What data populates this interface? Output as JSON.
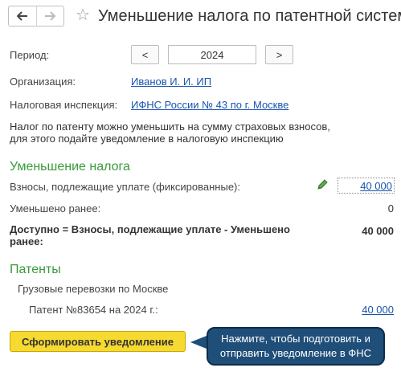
{
  "header": {
    "title": "Уменьшение налога по патентной системе"
  },
  "period": {
    "label": "Период:",
    "prev": "<",
    "year": "2024",
    "next": ">"
  },
  "organization": {
    "label": "Организация:",
    "value": "Иванов И. И. ИП"
  },
  "tax_office": {
    "label": "Налоговая инспекция:",
    "value": "ИФНС России № 43 по г. Москве"
  },
  "info": {
    "line1": "Налог по патенту можно уменьшить на сумму страховых взносов,",
    "line2": "для этого подайте уведомление в налоговую инспекцию"
  },
  "reduction": {
    "heading": "Уменьшение налога",
    "contributions_label": "Взносы, подлежащие уплате (фиксированные):",
    "contributions_value": "40 000",
    "reduced_label": "Уменьшено ранее:",
    "reduced_value": "0",
    "available_label_1": "Доступно = Взносы, подлежащие уплате - Уменьшено",
    "available_label_2": "ранее:",
    "available_value": "40 000"
  },
  "patents": {
    "heading": "Патенты",
    "group": "Грузовые перевозки по Москве",
    "item_label": "Патент №83654 на 2024 г.:",
    "item_value": "40 000"
  },
  "actions": {
    "submit": "Сформировать уведомление"
  },
  "tooltip": {
    "line1": "Нажмите, чтобы подготовить и",
    "line2": "отправить уведомление в ФНС"
  },
  "icons": {
    "back": "arrow-left-icon",
    "forward": "arrow-right-icon",
    "favorite": "star-icon",
    "edit": "pencil-icon"
  },
  "colors": {
    "section_heading": "#3a9a3a",
    "link": "#1a55b0",
    "primary_button": "#f6d931",
    "tooltip_bg": "#1f4e79"
  }
}
